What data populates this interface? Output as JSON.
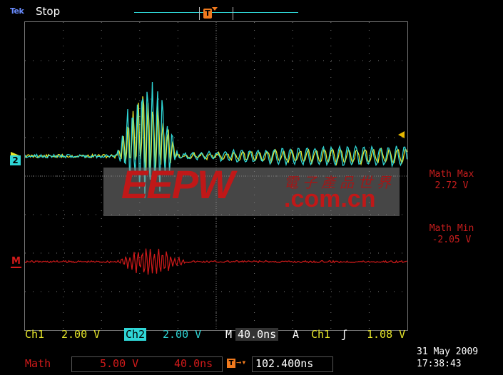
{
  "brand": "Tek",
  "status": "Stop",
  "trigger_marker": "T",
  "right_labels": {
    "math_max_label": "Math Max",
    "math_max_value": "2.72 V",
    "math_min_label": "Math Min",
    "math_min_value": "-2.05 V"
  },
  "watermark": {
    "logo": "EEPW",
    "domain": ".com.cn",
    "chinese": "電子產品世界"
  },
  "channel_markers": {
    "ch2": "2",
    "math": "M"
  },
  "bottom": {
    "ch1_label": "Ch1",
    "ch1_scale": "2.00 V",
    "ch2_label": "Ch2",
    "ch2_scale": "2.00 V",
    "timebase_label": "M",
    "timebase_value": "40.0ns",
    "trigger_mode": "A",
    "trigger_source": "Ch1",
    "trigger_slope": "ʃ",
    "trigger_level": "1.08 V",
    "math_label": "Math",
    "math_scale": "5.00 V",
    "math_time": "40.0ns",
    "trig_pos_value": "102.400ns",
    "date": "31 May 2009",
    "time": "17:38:43"
  },
  "colors": {
    "ch1": "#e6e62a",
    "ch2": "#2fd6d6",
    "math": "#d21a1a",
    "trigger": "#f07a1e",
    "grid": "#7a7a7a"
  }
}
